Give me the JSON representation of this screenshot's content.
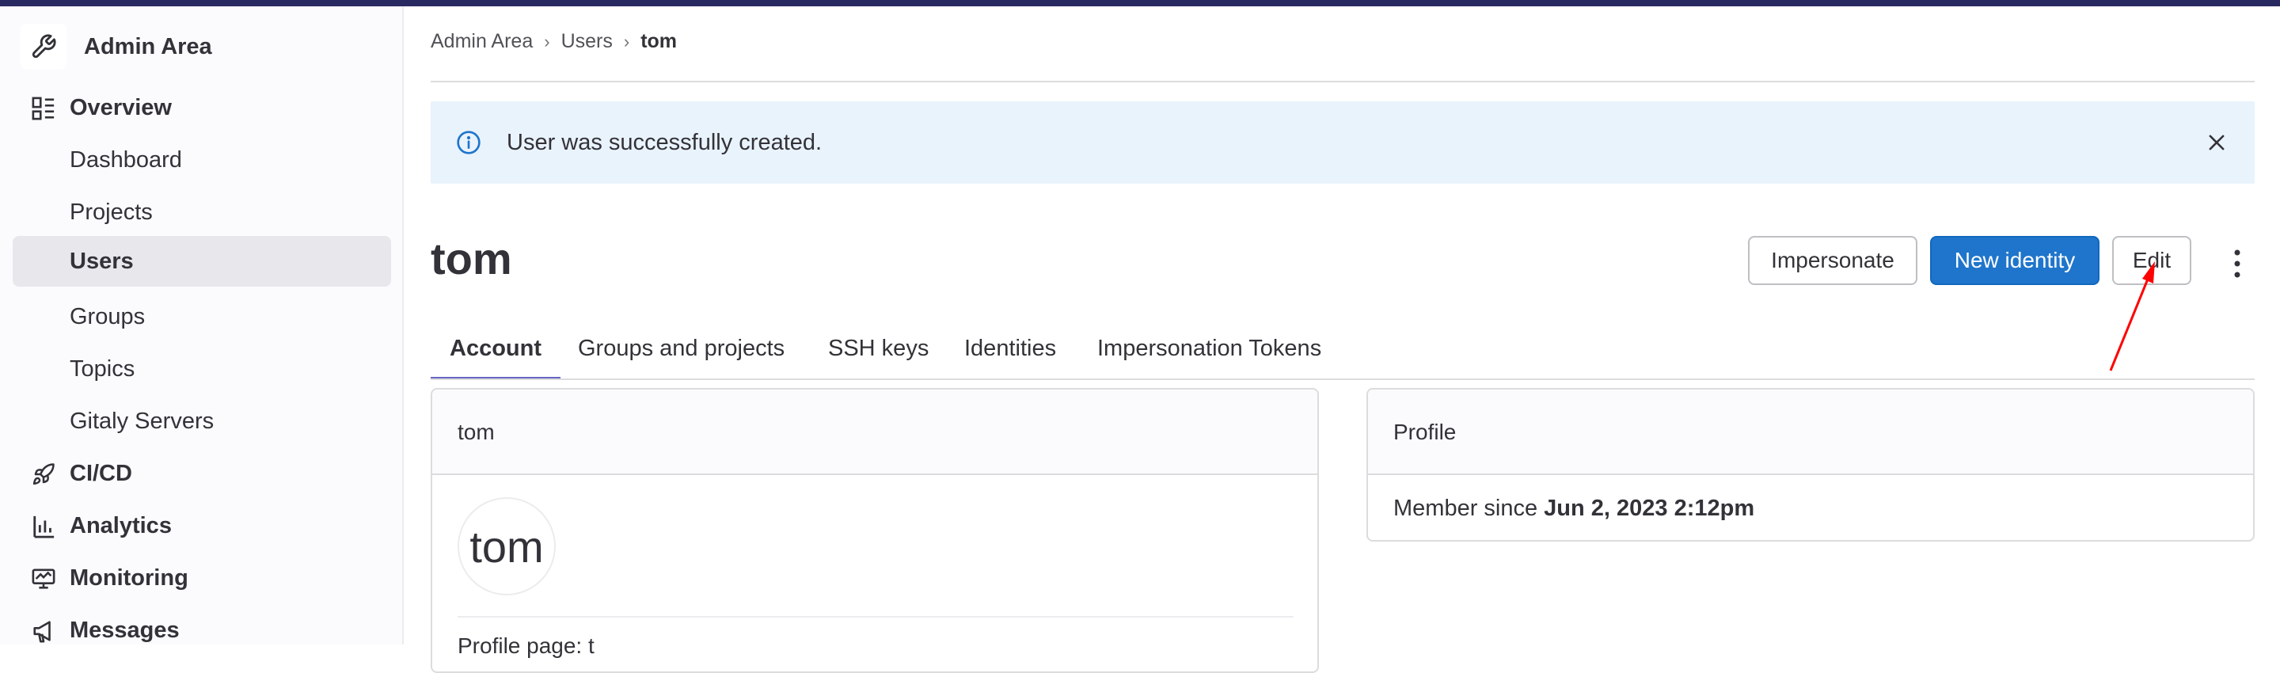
{
  "sidebar": {
    "title": "Admin Area",
    "items": [
      {
        "label": "Overview",
        "icon": "overview-icon",
        "section": true
      },
      {
        "label": "Dashboard"
      },
      {
        "label": "Projects"
      },
      {
        "label": "Users",
        "active": true
      },
      {
        "label": "Groups"
      },
      {
        "label": "Topics"
      },
      {
        "label": "Gitaly Servers"
      },
      {
        "label": "CI/CD",
        "icon": "rocket-icon",
        "section": true
      },
      {
        "label": "Analytics",
        "icon": "analytics-icon",
        "section": true
      },
      {
        "label": "Monitoring",
        "icon": "monitor-icon",
        "section": true
      },
      {
        "label": "Messages",
        "icon": "megaphone-icon",
        "section": true
      }
    ]
  },
  "breadcrumb": {
    "items": [
      "Admin Area",
      "Users",
      "tom"
    ]
  },
  "alert": {
    "message": "User was successfully created."
  },
  "page": {
    "title": "tom"
  },
  "actions": {
    "impersonate": "Impersonate",
    "new_identity": "New identity",
    "edit": "Edit"
  },
  "tabs": [
    "Account",
    "Groups and projects",
    "SSH keys",
    "Identities",
    "Impersonation Tokens"
  ],
  "account_card": {
    "header": "tom",
    "avatar_text": "tom",
    "cut_off_text": "Profile page: t"
  },
  "profile_card": {
    "header": "Profile",
    "member_since_label": "Member since ",
    "member_since_value": "Jun 2, 2023 2:12pm"
  },
  "colors": {
    "accent": "#1f75cb",
    "tab_underline": "#6666c4",
    "topbar": "#292961",
    "alert_bg": "#e9f3fc",
    "annotation": "#ff0000"
  }
}
